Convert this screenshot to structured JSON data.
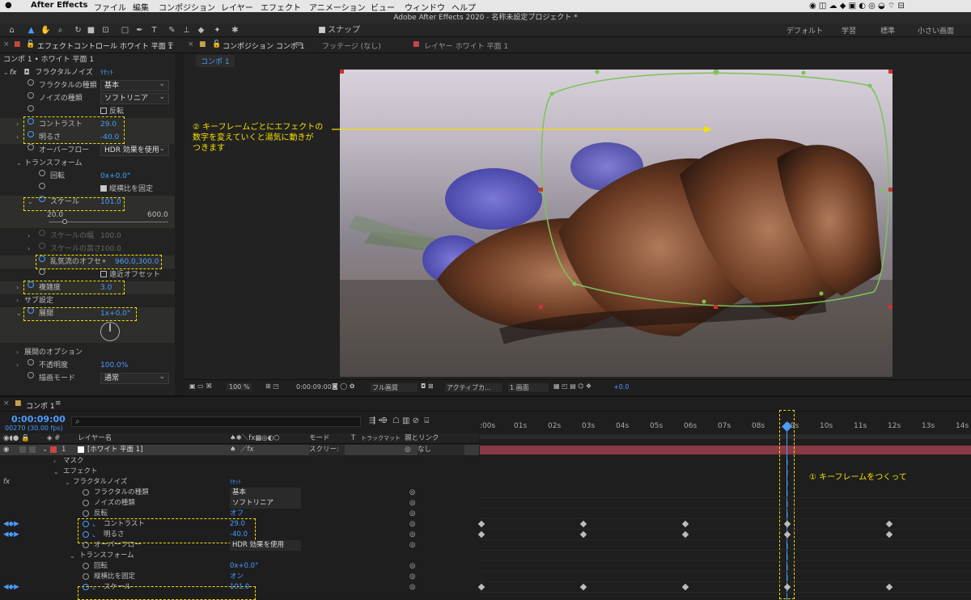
{
  "menubar": {
    "items": [
      "After Effects",
      "ファイル",
      "編集",
      "コンポジション",
      "レイヤー",
      "エフェクト",
      "アニメーション",
      "ビュー",
      "ウィンドウ",
      "ヘルプ"
    ]
  },
  "window_title": "Adobe After Effects 2020 - 名称未設定プロジェクト *",
  "toolbar": {
    "snap_label": "スナップ",
    "workspaces": [
      "デフォルト",
      "学習",
      "標準",
      "小さい画面"
    ]
  },
  "panels": {
    "effect_controls_tab": "エフェクトコントロール ホワイト 平面 1",
    "composition_tab": "コンポジション コンポ 1",
    "footage_tab": "フッテージ (なし)",
    "layer_tab": "レイヤー ホワイト 平面 1",
    "comp_subtab": "コンポ 1"
  },
  "effect_controls": {
    "breadcrumb": "コンポ 1 • ホワイト 平面 1",
    "effect_name": "フラクタルノイズ",
    "reset": "ﾘｾｯﾄ",
    "fractal_type_label": "フラクタルの種類",
    "fractal_type_value": "基本",
    "noise_type_label": "ノイズの種類",
    "noise_type_value": "ソフトリニア",
    "invert_label": "反転",
    "contrast_label": "コントラスト",
    "contrast_value": "29.0",
    "brightness_label": "明るさ",
    "brightness_value": "-40.0",
    "overflow_label": "オーバーフロー",
    "overflow_value": "HDR 効果を使用",
    "transform_label": "トランスフォーム",
    "rotation_label": "回転",
    "rotation_value": "0x+0.0°",
    "uniform_label": "縦横比を固定",
    "scale_label": "スケール",
    "scale_value": "101.0",
    "scale_min": "20.0",
    "scale_max": "600.0",
    "scale_w_label": "スケールの幅",
    "scale_w_value": "100.0",
    "scale_h_label": "スケールの高さ",
    "scale_h_value": "100.0",
    "offset_label": "乱気流のオフセ",
    "offset_value": "960.0,300.0",
    "persp_label": "遠近オフセット",
    "complexity_label": "複雑度",
    "complexity_value": "3.0",
    "sub_label": "サブ設定",
    "evolution_label": "展開",
    "evolution_value": "1x+0.0°",
    "evo_options_label": "展開のオプション",
    "opacity_label": "不透明度",
    "opacity_value": "100.0%",
    "blend_label": "描画モード",
    "blend_value": "通常"
  },
  "annotation_top": [
    "② キーフレームごとにエフェクトの",
    "数字を変えていくと湯気に動きが",
    "つきます"
  ],
  "annotation_bottom": "① キーフレームをつくって",
  "comp_bar": {
    "zoom": "100 %",
    "time": "0:00:09:00",
    "quality": "フル画質",
    "camera": "アクティブカ...",
    "views": "1 画面",
    "exposure": "+0.0"
  },
  "timeline": {
    "tab": "コンポ 1",
    "timecode": "0:00:09:00",
    "frames": "00270 (30.00 fps)",
    "col_layer": "レイヤー名",
    "col_mode": "モード",
    "col_t": "T",
    "col_trkmat": "トラックマット",
    "col_parent": "親とリンク",
    "layer_num": "1",
    "layer_name": "[ホワイト 平面 1]",
    "layer_mode": "スクリー:",
    "parent_value": "なし",
    "mask_label": "マスク",
    "effect_label": "エフェクト",
    "fx_name": "フラクタルノイズ",
    "fx_reset": "ﾘｾｯﾄ",
    "fractal_label": "フラクタルの種類",
    "fractal_value": "基本",
    "noise_label": "ノイズの種類",
    "noise_value": "ソフトリニア",
    "invert_label": "反転",
    "invert_value": "オフ",
    "contrast_label": "コントラスト",
    "contrast_value": "29.0",
    "brightness_label": "明るさ",
    "brightness_value": "-40.0",
    "overflow_label": "オーバーフロー",
    "overflow_value": "HDR 効果を使用",
    "transform_label": "トランスフォーム",
    "rotation_label": "回転",
    "rotation_value": "0x+0.0°",
    "uniform_label": "縦横比を固定",
    "uniform_value": "オン",
    "scale_label": "スケール",
    "scale_value": "101.0",
    "ruler": [
      ":00s",
      "01s",
      "02s",
      "03s",
      "04s",
      "05s",
      "06s",
      "07s",
      "08s",
      "09s",
      "10s",
      "11s",
      "12s",
      "13s",
      "14s"
    ]
  },
  "colors": {
    "accent": "#4a9cff",
    "annotation": "#f5e000",
    "layer_bar": "#8a3a45"
  }
}
